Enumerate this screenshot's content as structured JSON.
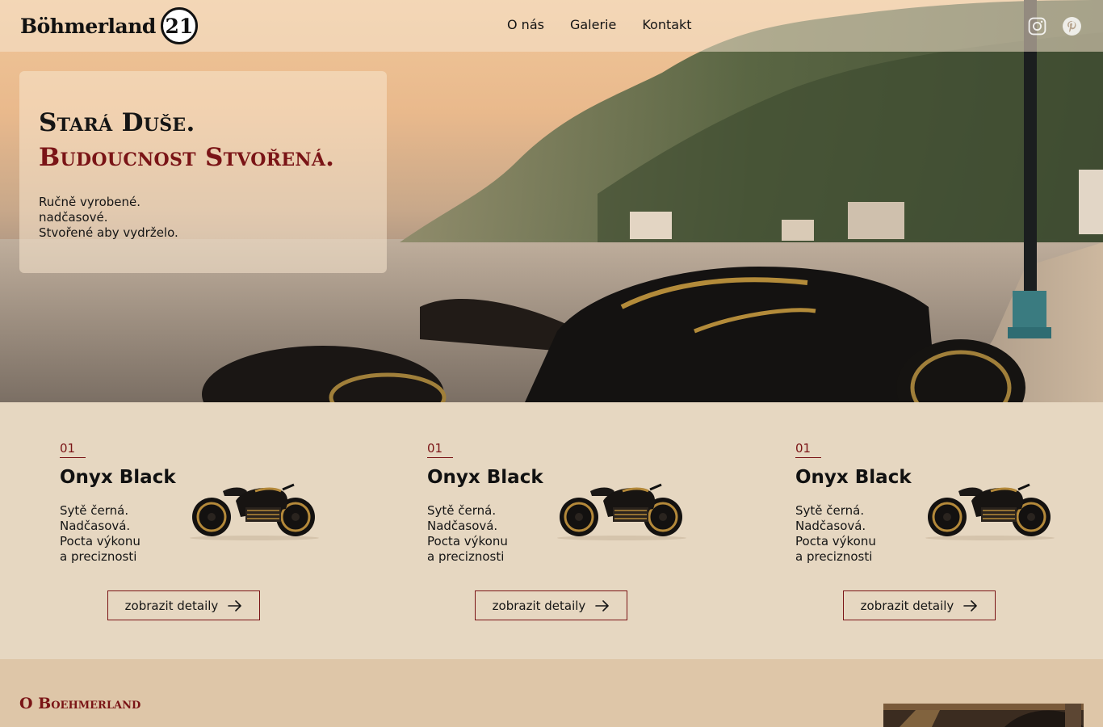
{
  "header": {
    "logo_word": "Böhmerland",
    "logo_badge": "21",
    "nav": [
      "O nás",
      "Galerie",
      "Kontakt"
    ],
    "social": [
      "instagram-icon",
      "pinterest-icon"
    ]
  },
  "hero": {
    "title_line1": "Stará Duše.",
    "title_line2": "Budoucnost Stvořená.",
    "text": [
      "Ručně vyrobené.",
      "nadčasové.",
      "Stvořené aby vydrželo."
    ]
  },
  "products": [
    {
      "number": "01",
      "title": "Onyx Black",
      "desc": [
        "Sytě černá.",
        "Nadčasová.",
        "Pocta výkonu",
        "a preciznosti"
      ],
      "button": "zobrazit detaily"
    },
    {
      "number": "01",
      "title": "Onyx Black",
      "desc": [
        "Sytě černá.",
        "Nadčasová.",
        "Pocta výkonu",
        "a preciznosti"
      ],
      "button": "zobrazit detaily"
    },
    {
      "number": "01",
      "title": "Onyx Black",
      "desc": [
        "Sytě černá.",
        "Nadčasová.",
        "Pocta výkonu",
        "a preciznosti"
      ],
      "button": "zobrazit detaily"
    }
  ],
  "about": {
    "title": "O Boehmerland"
  },
  "colors": {
    "accent": "#7a1416",
    "page_bg": "#e6d7c1",
    "about_bg": "#dec6a8"
  }
}
